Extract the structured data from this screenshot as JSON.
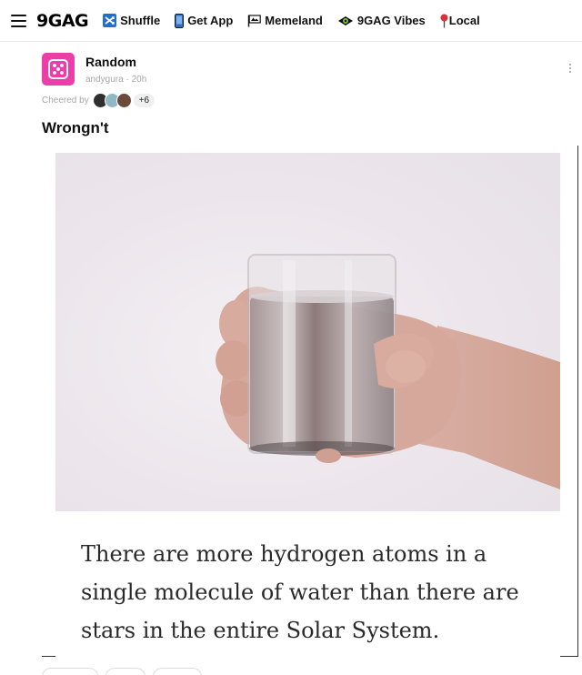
{
  "nav": {
    "logo": "9GAG",
    "items": [
      {
        "label": "Shuffle",
        "icon": "shuffle-icon"
      },
      {
        "label": "Get App",
        "icon": "phone-icon"
      },
      {
        "label": "Memeland",
        "icon": "flag-icon"
      },
      {
        "label": "9GAG Vibes",
        "icon": "vibes-icon"
      },
      {
        "label": "Local",
        "icon": "pin-icon"
      }
    ]
  },
  "post": {
    "section": "Random",
    "author": "andygura",
    "age": "20h",
    "cheered_label": "Cheered by",
    "cheer_count": "+6",
    "title": "Wrongn't",
    "caption": "There are more hydrogen atoms in a single molecule of water than there are stars in the entire Solar System."
  },
  "colors": {
    "section_avatar": "#ec3ea9",
    "shuffle_icon": "#1f6fd1",
    "vibes_icon": "#7dbd3f",
    "local_pin": "#d6333d"
  }
}
